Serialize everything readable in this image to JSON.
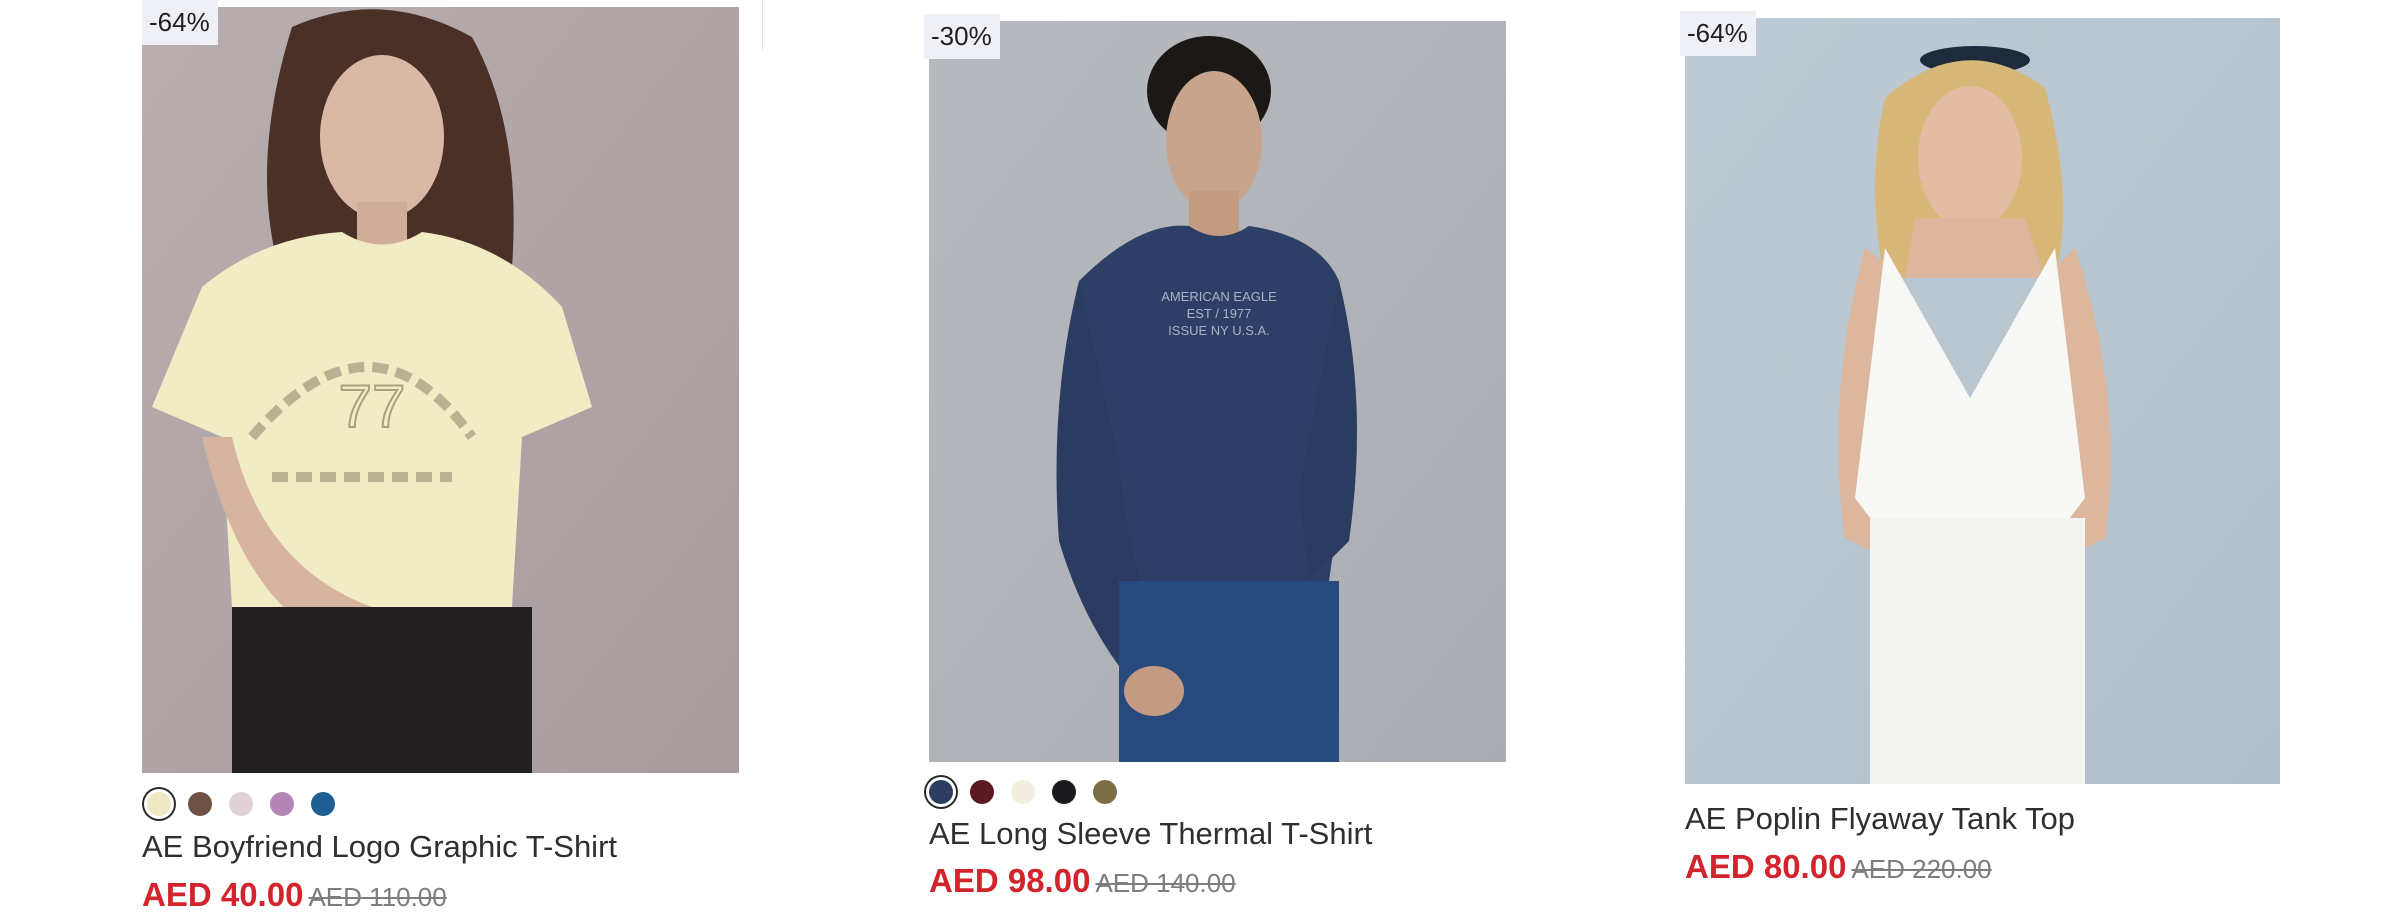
{
  "products": [
    {
      "discount_badge": "-64%",
      "title": "AE Boyfriend Logo Graphic T-Shirt",
      "price": "AED 40.00",
      "original_price": "AED 110.00",
      "image_label": "product-photo-woman-yellow-graphic-tee",
      "swatches": [
        {
          "color": "#efe9c4",
          "selected": true
        },
        {
          "color": "#6e5044",
          "selected": false
        },
        {
          "color": "#e2d2d8",
          "selected": false
        },
        {
          "color": "#b386b5",
          "selected": false
        },
        {
          "color": "#1f5f94",
          "selected": false
        }
      ]
    },
    {
      "discount_badge": "-30%",
      "title": "AE Long Sleeve Thermal T-Shirt",
      "price": "AED 98.00",
      "original_price": "AED 140.00",
      "image_label": "product-photo-man-navy-thermal",
      "swatches": [
        {
          "color": "#2d3e62",
          "selected": true
        },
        {
          "color": "#5b1a22",
          "selected": false
        },
        {
          "color": "#f2eedf",
          "selected": false
        },
        {
          "color": "#1b1b1d",
          "selected": false
        },
        {
          "color": "#7c6f45",
          "selected": false
        }
      ]
    },
    {
      "discount_badge": "-64%",
      "title": "AE Poplin Flyaway Tank Top",
      "price": "AED 80.00",
      "original_price": "AED 220.00",
      "image_label": "product-photo-woman-white-tank",
      "swatches": []
    }
  ],
  "colors": {
    "sale_price": "#d3232c",
    "badge_bg": "#eef0f6",
    "old_price": "#7d7d7d"
  }
}
